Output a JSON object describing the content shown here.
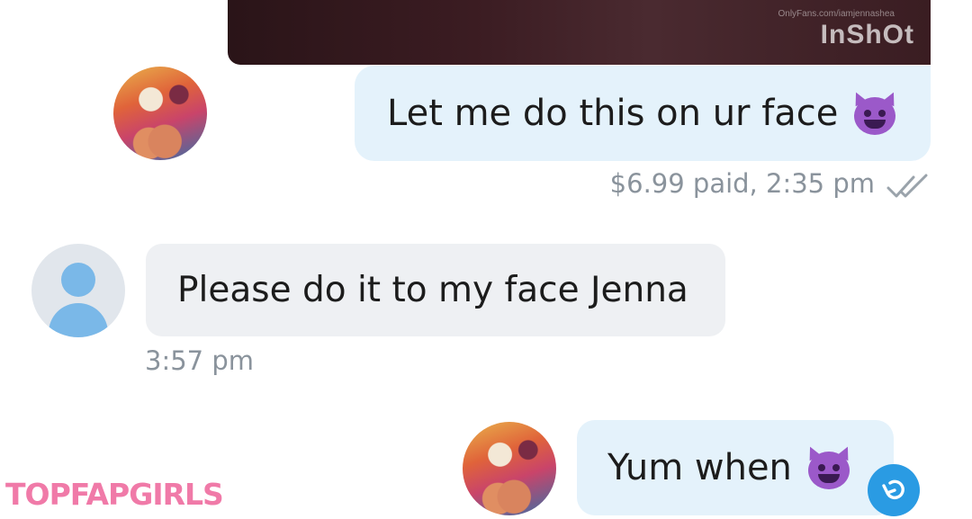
{
  "media": {
    "watermark_url": "OnlyFans.com/iamjennashea",
    "watermark_app": "InShOt"
  },
  "messages": [
    {
      "direction": "outgoing",
      "text": "Let me do this on ur face",
      "emoji": "smiling-devil-icon",
      "price_paid": "$6.99 paid,",
      "time": "2:35 pm",
      "status_icon": "double-check-icon"
    },
    {
      "direction": "incoming",
      "text": "Please do it to my face Jenna",
      "time": "3:57 pm"
    },
    {
      "direction": "outgoing",
      "text": "Yum when",
      "emoji": "smiling-devil-icon"
    }
  ],
  "overlay": {
    "brand": "TOPFAPGIRLS",
    "undo_icon": "undo-icon"
  },
  "colors": {
    "outgoing_bubble": "#e4f2fb",
    "incoming_bubble": "#eef0f3",
    "meta_text": "#8a939c",
    "accent": "#2a9be3",
    "brand": "#f07aa8",
    "emoji": "#9b59c9"
  }
}
